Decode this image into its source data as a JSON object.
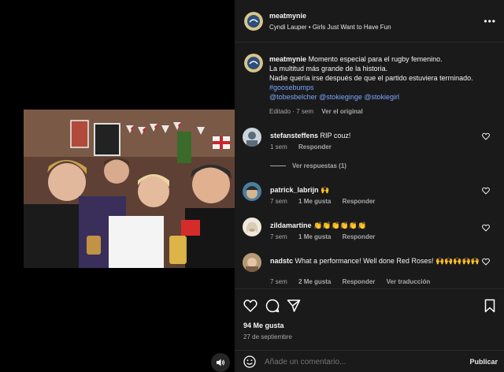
{
  "post": {
    "username": "meatmynie",
    "audio": "Cyndi Lauper • Girls Just Want to Have Fun",
    "caption_lines": [
      "Momento especial para el rugby femenino.",
      "La multitud más grande de la historia.",
      "Nadie quería irse después de que el partido estuviera terminado."
    ],
    "hashtag": "#goosebumps",
    "mentions": "@tobesbelcher @stokieginge @stokiegirl",
    "edited": "Editado · 7 sem",
    "see_original": "Ver el original",
    "likes": "94 Me gusta",
    "date": "27 de septiembre",
    "comment_placeholder": "Añade un comentario...",
    "publish": "Publicar"
  },
  "comments": [
    {
      "user": "stefansteffens",
      "text": "RIP couz!",
      "time": "1 sem",
      "likes": "",
      "reply": "Responder",
      "extra": ""
    },
    {
      "user": "patrick_labrijn",
      "text": "🙌",
      "time": "7 sem",
      "likes": "1 Me gusta",
      "reply": "Responder",
      "extra": ""
    },
    {
      "user": "zildamartine",
      "text": "👏👏👏👏👏👏",
      "time": "7 sem",
      "likes": "1 Me gusta",
      "reply": "Responder",
      "extra": ""
    },
    {
      "user": "nadstc",
      "text": "What a performance! Well done Red Roses! 🙌🙌🙌🙌🙌",
      "time": "7 sem",
      "likes": "2 Me gusta",
      "reply": "Responder",
      "extra": "Ver traducción"
    }
  ],
  "view_replies": "Ver respuestas (1)",
  "colors": {
    "bg": "#1a1a1a",
    "link": "#7aa7ff",
    "muted": "#a8a8a8"
  }
}
